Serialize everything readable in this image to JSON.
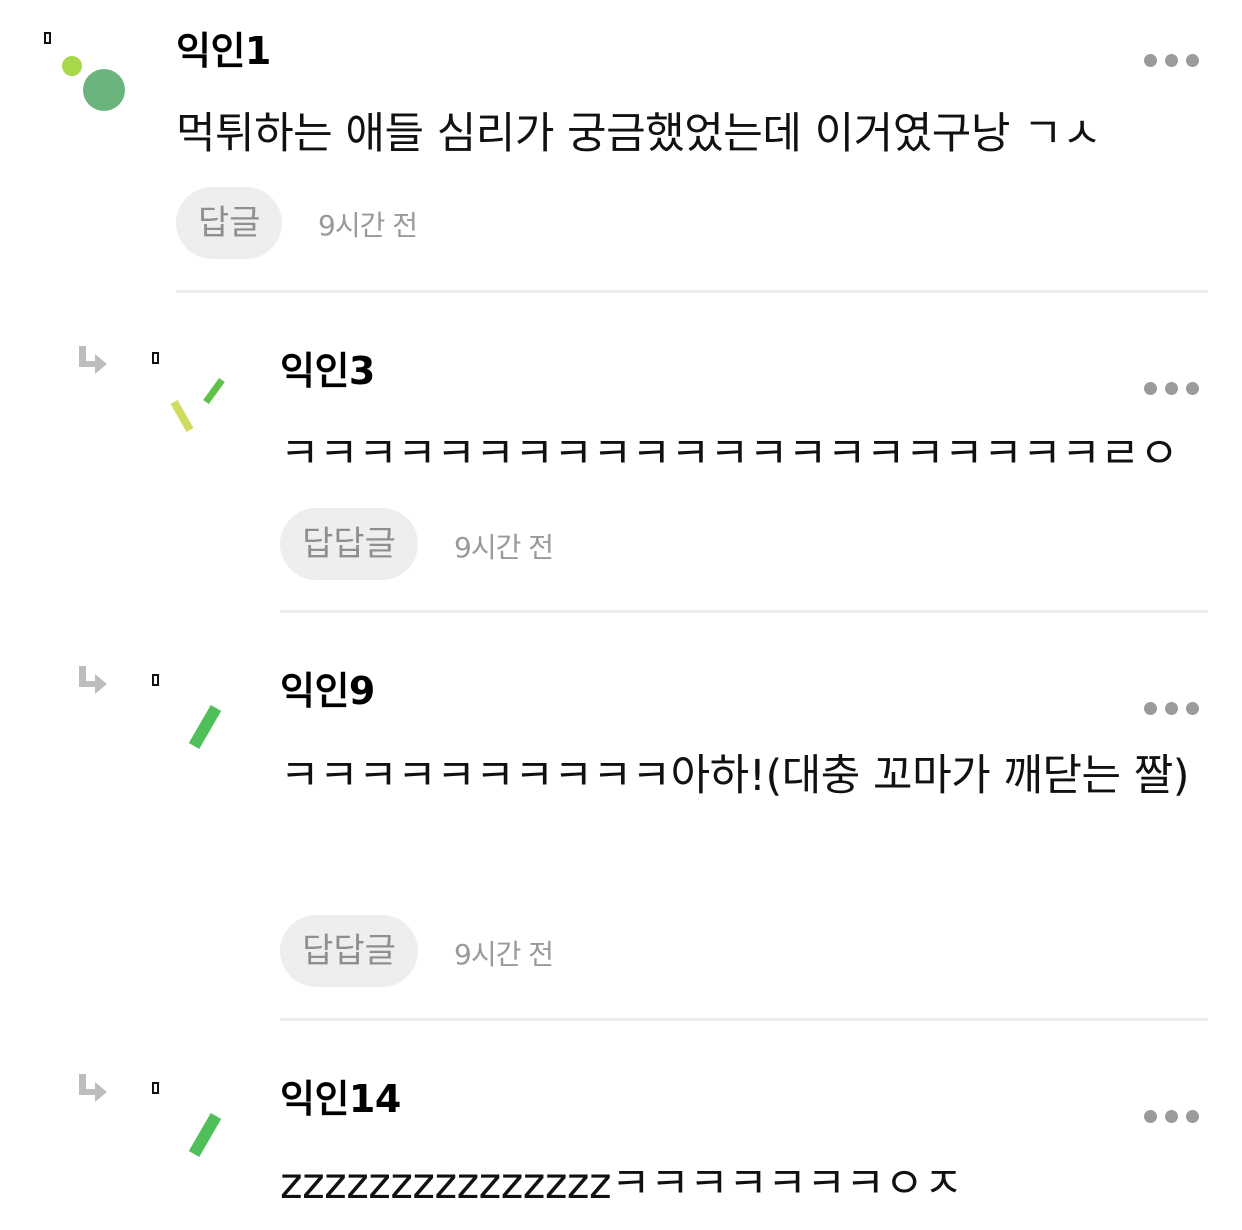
{
  "comments": [
    {
      "nickname": "익인1",
      "text": "먹튀하는 애들 심리가 궁금했었는데 이거였구낭 ㄱㅅ",
      "reply_label": "답글",
      "time": "9시간 전",
      "more_icon": "more-horizontal-icon",
      "avatar_colors": [
        "#a7d84a",
        "#6cb47e"
      ]
    },
    {
      "nickname": "익인3",
      "text": "ㅋㅋㅋㅋㅋㅋㅋㅋㅋㅋㅋㅋㅋㅋㅋㅋㅋㅋㅋㅋㅋㄹㅇ",
      "reply_label": "답답글",
      "time": "9시간 전",
      "more_icon": "more-horizontal-icon",
      "avatar_colors": [
        "#cfdc5e",
        "#5fc04a"
      ]
    },
    {
      "nickname": "익인9",
      "text": "ㅋㅋㅋㅋㅋㅋㅋㅋㅋㅋ아하!(대충 꼬마가 깨닫는 짤)",
      "reply_label": "답답글",
      "time": "9시간 전",
      "more_icon": "more-horizontal-icon",
      "avatar_colors": [
        "#4fbf5a"
      ]
    },
    {
      "nickname": "익인14",
      "text": "zzzzzzzzzzzzzzzㅋㅋㅋㅋㅋㅋㅋㅇㅈ",
      "more_icon": "more-horizontal-icon",
      "avatar_colors": [
        "#4fbf5a"
      ]
    }
  ]
}
